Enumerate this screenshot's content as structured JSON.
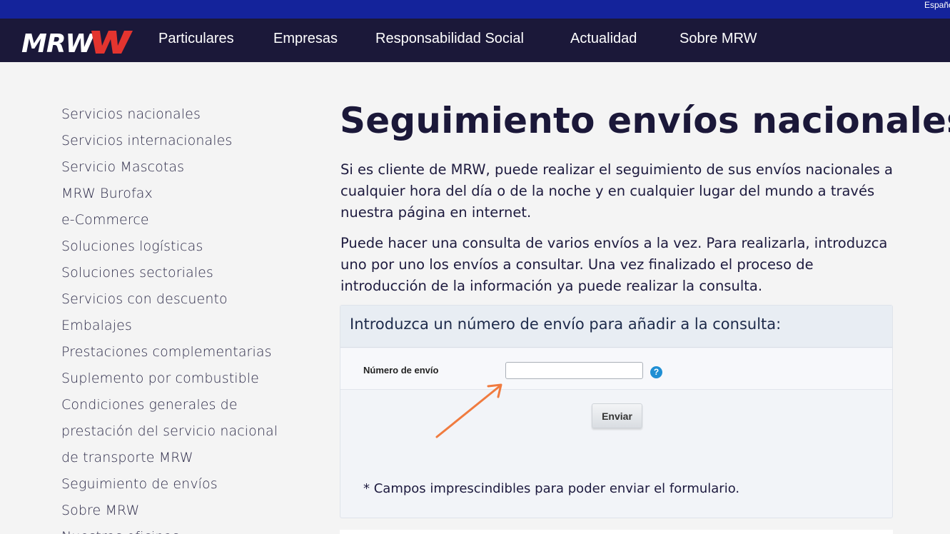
{
  "topbar": {
    "language": "Español"
  },
  "nav": {
    "logo": "MRW",
    "items": [
      {
        "label": "Particulares"
      },
      {
        "label": "Empresas"
      },
      {
        "label": "Responsabilidad Social"
      },
      {
        "label": "Actualidad"
      },
      {
        "label": "Sobre MRW"
      }
    ]
  },
  "sidebar": {
    "items": [
      {
        "label": "Servicios nacionales"
      },
      {
        "label": "Servicios internacionales"
      },
      {
        "label": "Servicio Mascotas"
      },
      {
        "label": "MRW Burofax"
      },
      {
        "label": "e-Commerce"
      },
      {
        "label": "Soluciones logísticas"
      },
      {
        "label": "Soluciones sectoriales"
      },
      {
        "label": "Servicios con descuento"
      },
      {
        "label": "Embalajes"
      },
      {
        "label": "Prestaciones complementarias"
      },
      {
        "label": "Suplemento por combustible"
      },
      {
        "label": "Condiciones generales de"
      },
      {
        "label": "prestación del servicio nacional"
      },
      {
        "label": "de transporte MRW"
      },
      {
        "label": "Seguimiento de envíos"
      },
      {
        "label": "Sobre MRW"
      },
      {
        "label": "Nuestras oficinas"
      }
    ]
  },
  "main": {
    "title": "Seguimiento envíos nacionales",
    "paragraph1": "Si es cliente de MRW, puede realizar el seguimiento de sus envíos nacionales a cualquier hora del día o de la noche y en cualquier lugar del mundo a través nuestra página en internet.",
    "paragraph2": "Puede hacer una consulta de varios envíos a la vez. Para realizarla, introduzca uno por uno los envíos a consultar. Una vez finalizado el proceso de introducción de la información ya puede realizar la consulta."
  },
  "form": {
    "heading": "Introduzca un número de envío para añadir a la consulta:",
    "field_label": "Número de envío",
    "field_value": "",
    "help_icon": "question-icon",
    "submit_label": "Enviar",
    "footnote": "* Campos imprescindibles para poder enviar el formulario."
  },
  "colors": {
    "topbar": "#14239b",
    "nav": "#1b1839",
    "accent_arrow": "#f07b3f",
    "help": "#1f8fd4"
  }
}
